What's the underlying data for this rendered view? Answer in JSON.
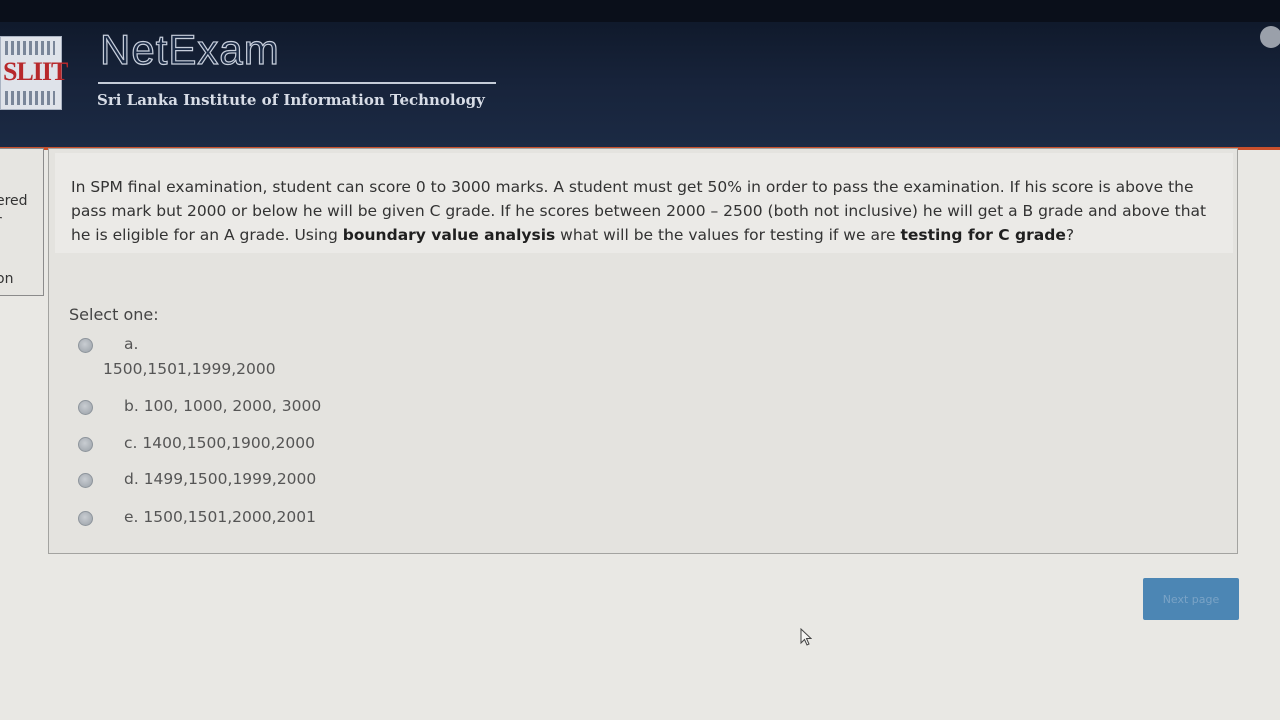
{
  "header": {
    "logo_text": "SLIIT",
    "brand_title": "NetExam",
    "brand_subtitle": "Sri Lanka Institute of Information Technology"
  },
  "side_panel": {
    "line1": "ered",
    "line2": "r",
    "line3": "on"
  },
  "question": {
    "part1": "In SPM final examination, student can score 0 to 3000 marks. A student must get 50% in order to pass the examination. If his score is above the pass mark but 2000 or below he will be given C grade. If he scores between 2000 – 2500 (both not inclusive) he will get a B grade and above that he is eligible for an A grade. Using ",
    "bold1": "boundary value analysis",
    "part2": " what will be the values for testing if we are ",
    "bold2": "testing for C grade",
    "part3": "?"
  },
  "select_label": "Select one:",
  "options": [
    {
      "letter": "a.",
      "text": "1500,1501,1999,2000"
    },
    {
      "text": "b. 100, 1000, 2000, 3000"
    },
    {
      "text": "c. 1400,1500,1900,2000"
    },
    {
      "text": "d. 1499,1500,1999,2000"
    },
    {
      "text": "e. 1500,1501,2000,2001"
    }
  ],
  "next_button": "Next page"
}
